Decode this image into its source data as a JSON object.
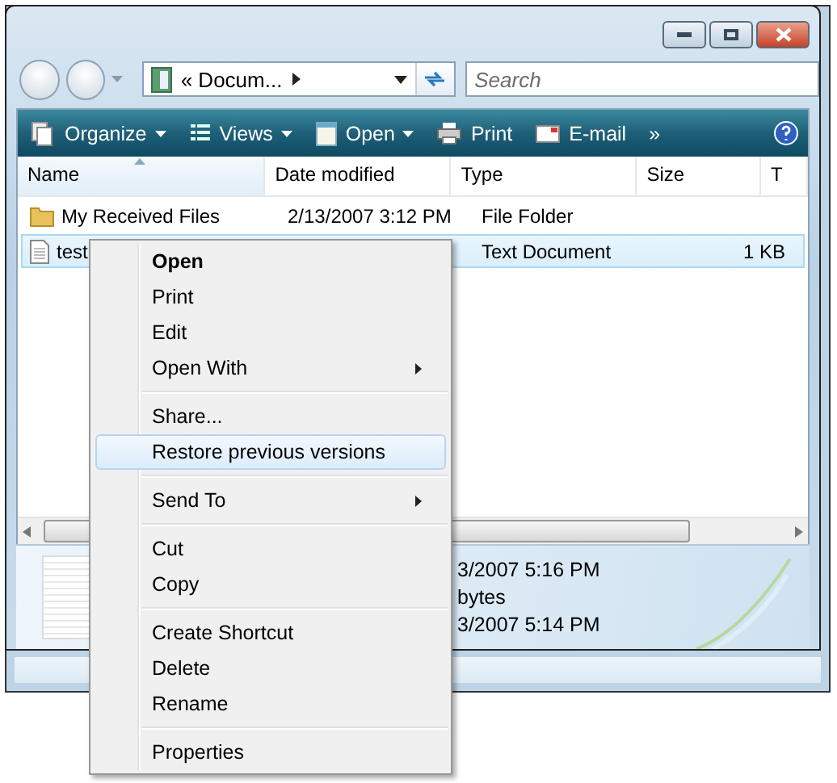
{
  "navigation": {
    "address": "« Docum...",
    "search": {
      "placeholder": "Search"
    }
  },
  "toolbar": [
    {
      "label": "Organize",
      "kind": "organize",
      "dropdown": true
    },
    {
      "label": "Views",
      "kind": "views",
      "dropdown": true
    },
    {
      "label": "Open",
      "kind": "open",
      "dropdown": true
    },
    {
      "label": "Print",
      "kind": "print",
      "dropdown": false
    },
    {
      "label": "E-mail",
      "kind": "email",
      "dropdown": false
    },
    {
      "label": "»",
      "kind": "more",
      "dropdown": false
    }
  ],
  "columns": [
    {
      "label": "Name",
      "sorted": true
    },
    {
      "label": "Date modified",
      "sorted": false
    },
    {
      "label": "Type",
      "sorted": false
    },
    {
      "label": "Size",
      "sorted": false
    },
    {
      "label": "T",
      "sorted": false
    }
  ],
  "rows": [
    {
      "kind": "folder",
      "name": "My Received Files",
      "date": "2/13/2007 3:12 PM",
      "type": "File Folder",
      "selected": false
    },
    {
      "kind": "text",
      "name": "test",
      "type": "Text Document",
      "size": "1 KB",
      "selected": true
    }
  ],
  "details": [
    "3/2007 5:16 PM",
    "bytes",
    "3/2007 5:14 PM"
  ],
  "context_menu": [
    [
      {
        "label": "Open",
        "default": true,
        "submenu": false,
        "selected": false
      },
      {
        "label": "Print",
        "default": false,
        "submenu": false,
        "selected": false
      },
      {
        "label": "Edit",
        "default": false,
        "submenu": false,
        "selected": false
      },
      {
        "label": "Open With",
        "default": false,
        "submenu": true,
        "selected": false
      }
    ],
    [
      {
        "label": "Share...",
        "default": false,
        "submenu": false,
        "selected": false
      },
      {
        "label": "Restore previous versions",
        "default": false,
        "submenu": false,
        "selected": true
      }
    ],
    [
      {
        "label": "Send To",
        "default": false,
        "submenu": true,
        "selected": false
      }
    ],
    [
      {
        "label": "Cut",
        "default": false,
        "submenu": false,
        "selected": false
      },
      {
        "label": "Copy",
        "default": false,
        "submenu": false,
        "selected": false
      }
    ],
    [
      {
        "label": "Create Shortcut",
        "default": false,
        "submenu": false,
        "selected": false
      },
      {
        "label": "Delete",
        "default": false,
        "submenu": false,
        "selected": false
      },
      {
        "label": "Rename",
        "default": false,
        "submenu": false,
        "selected": false
      }
    ],
    [
      {
        "label": "Properties",
        "default": false,
        "submenu": false,
        "selected": false
      }
    ]
  ]
}
